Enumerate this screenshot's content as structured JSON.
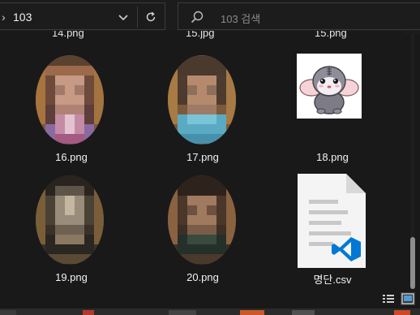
{
  "address_bar": {
    "path": "103",
    "placeholder_search": "103 검색"
  },
  "cut_row": {
    "labels": [
      "14.png",
      "15.jpg",
      "15.png"
    ]
  },
  "files": [
    {
      "name": "16.png",
      "kind": "image-portrait"
    },
    {
      "name": "17.png",
      "kind": "image-portrait"
    },
    {
      "name": "18.png",
      "kind": "image-sticker"
    },
    {
      "name": "19.png",
      "kind": "image-portrait"
    },
    {
      "name": "20.png",
      "kind": "image-portrait"
    },
    {
      "name": "명단.csv",
      "kind": "csv-vscode"
    }
  ],
  "icons": {
    "address_chevron": "chevron-left-icon",
    "dropdown": "chevron-down-icon",
    "refresh": "refresh-icon",
    "search": "search-icon",
    "details_view": "details-view-icon",
    "large_icons_view": "large-icons-view-icon",
    "csv_badge": "vscode-icon"
  },
  "colors": {
    "background": "#191919",
    "border": "#3b3b3b",
    "text": "#f2f2f2",
    "placeholder": "#8a8a8a",
    "accent_vscode": "#0078d4"
  }
}
